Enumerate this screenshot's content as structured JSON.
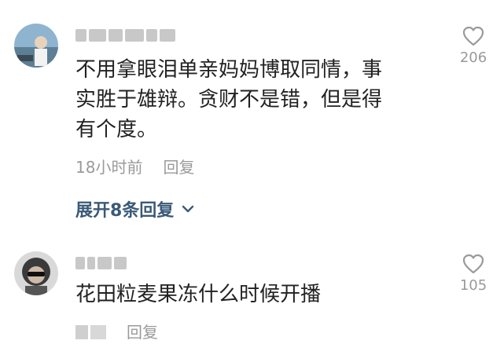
{
  "comments": [
    {
      "text": "不用拿眼泪单亲妈妈博取同情，事\n实胜于雄辩。贪财不是错，但是得\n有个度。",
      "time": "18小时前",
      "reply_label": "回复",
      "likes": "206",
      "expand_label": "展开8条回复",
      "icons": {
        "like": "heart-outline-icon",
        "expand": "chevron-down-icon"
      }
    },
    {
      "text": "花田粒麦果冻什么时候开播",
      "reply_label": "回复",
      "likes": "105",
      "icons": {
        "like": "heart-outline-icon"
      }
    }
  ],
  "colors": {
    "text": "#222222",
    "meta": "#9a9a9a",
    "expand": "#3a5a78"
  }
}
